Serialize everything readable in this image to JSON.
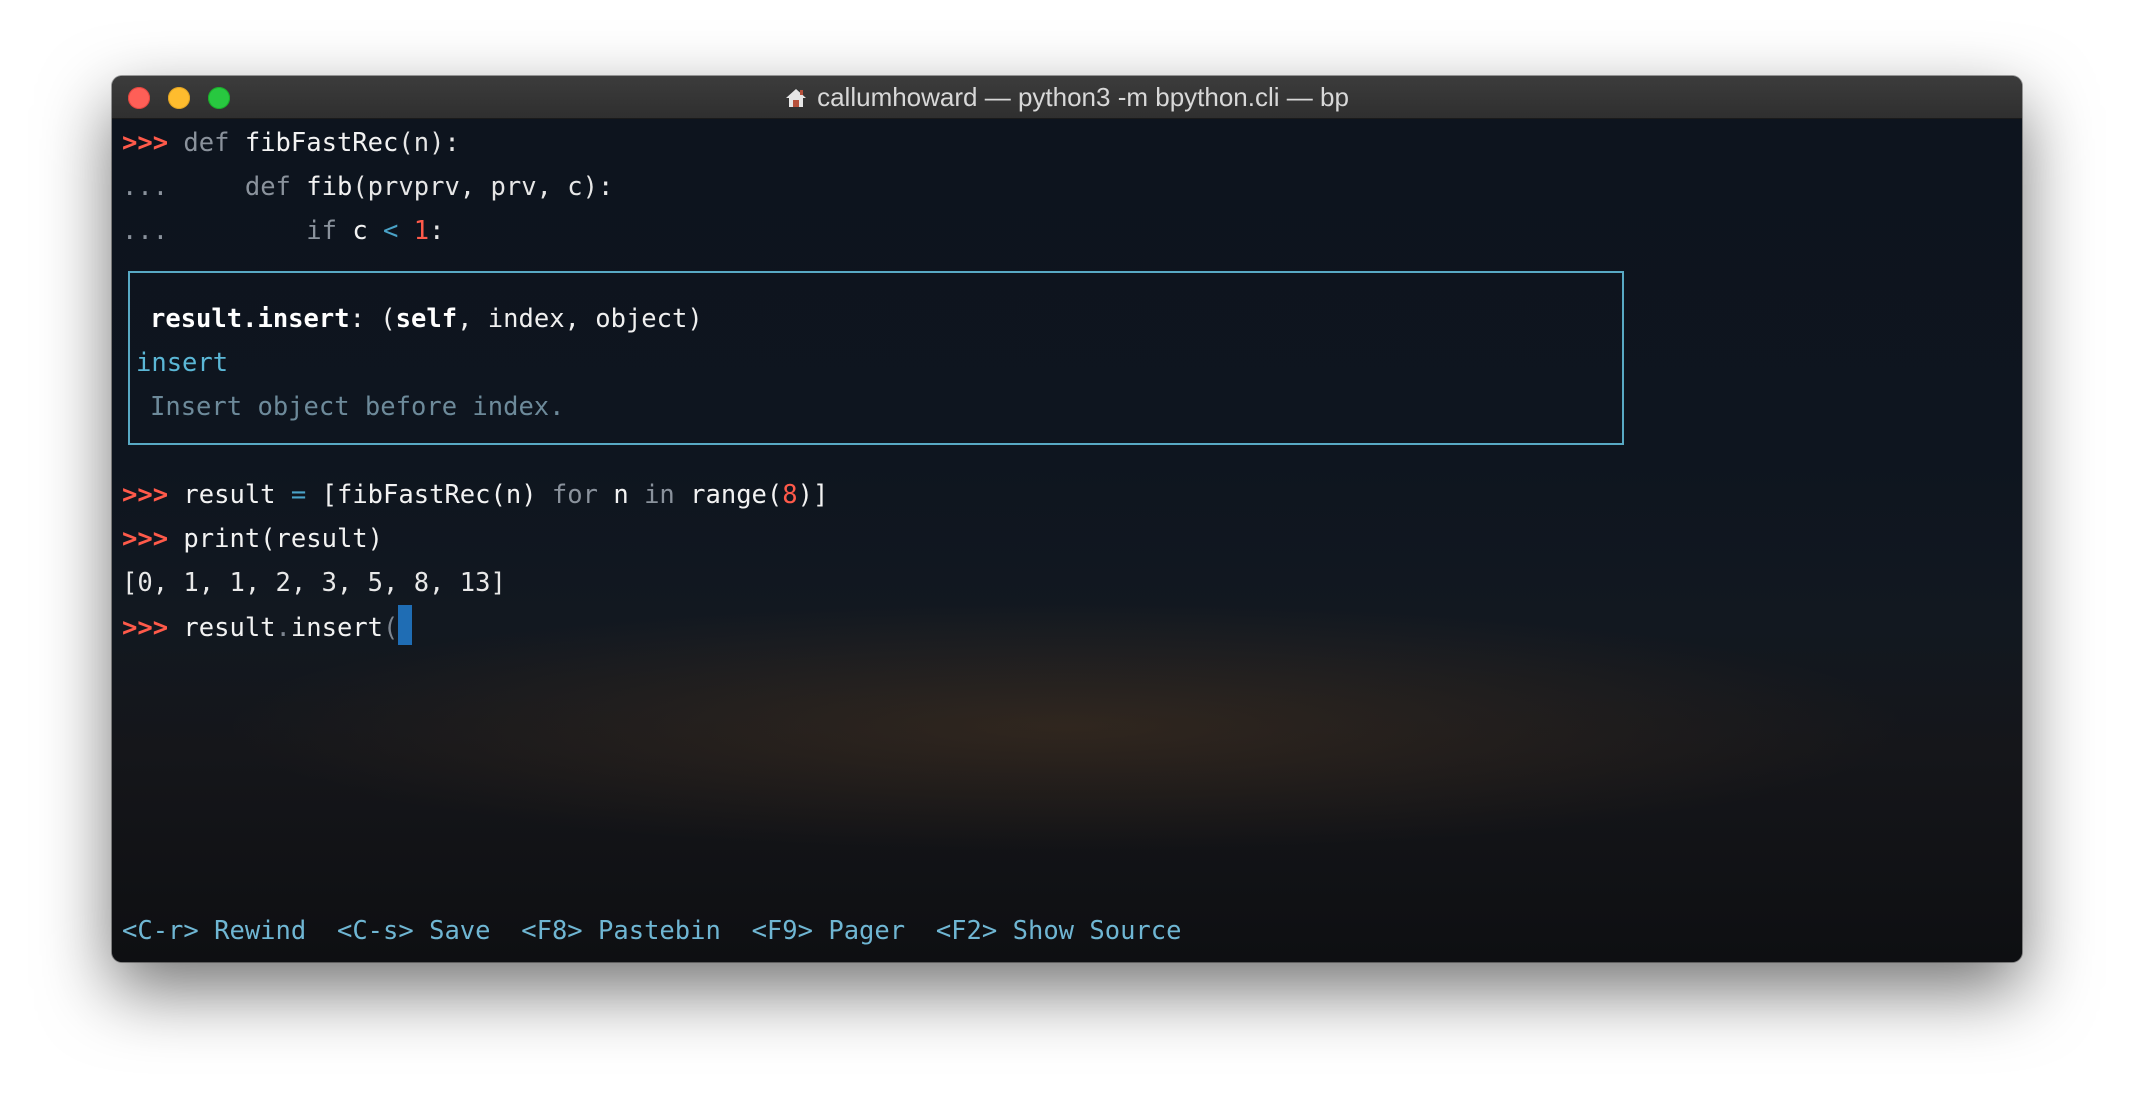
{
  "window": {
    "title": "callumhoward — python3 -m bpython.cli — bp",
    "title_icon": "home-icon"
  },
  "terminal": {
    "history": [
      {
        "prompt": ">>>",
        "kw": "def",
        "name": "fibFastRec",
        "rest": "(n):"
      },
      {
        "prompt": "...",
        "indent": "    ",
        "kw": "def",
        "name": "fib",
        "rest": "(prvprv, prv, c):"
      },
      {
        "prompt": "...",
        "indent": "        ",
        "kw": "if",
        "name": "c",
        "op": "<",
        "num": "1",
        "rest": ":"
      }
    ],
    "popup": {
      "signature_func": "result.insert",
      "signature_sep": ": (",
      "signature_self": "self",
      "signature_rest": ", index, object)",
      "name": "insert",
      "doc": "Insert object before index."
    },
    "lines_after": {
      "line1": {
        "prompt": ">>>",
        "a": "result",
        "eq": "=",
        "b": "[fibFastRec(n)",
        "for": "for",
        "n": "n",
        "in": "in",
        "range": "range(",
        "num": "8",
        "end": ")]"
      },
      "line2": {
        "prompt": ">>>",
        "text": "print(result)"
      },
      "line3": {
        "text": "[0, 1, 1, 2, 3, 5, 8, 13]"
      },
      "line4": {
        "prompt": ">>>",
        "a": "result",
        "dot": ".",
        "b": "insert",
        "paren": "("
      }
    },
    "footer": [
      {
        "key": "<C-r>",
        "label": "Rewind"
      },
      {
        "key": "<C-s>",
        "label": "Save"
      },
      {
        "key": "<F8>",
        "label": "Pastebin"
      },
      {
        "key": "<F9>",
        "label": "Pager"
      },
      {
        "key": "<F2>",
        "label": "Show Source"
      }
    ]
  },
  "colors": {
    "prompt": "#ff5a4a",
    "popup_border": "#58a9c4",
    "footer": "#6fb6d3",
    "cursor": "#1f6db4"
  }
}
